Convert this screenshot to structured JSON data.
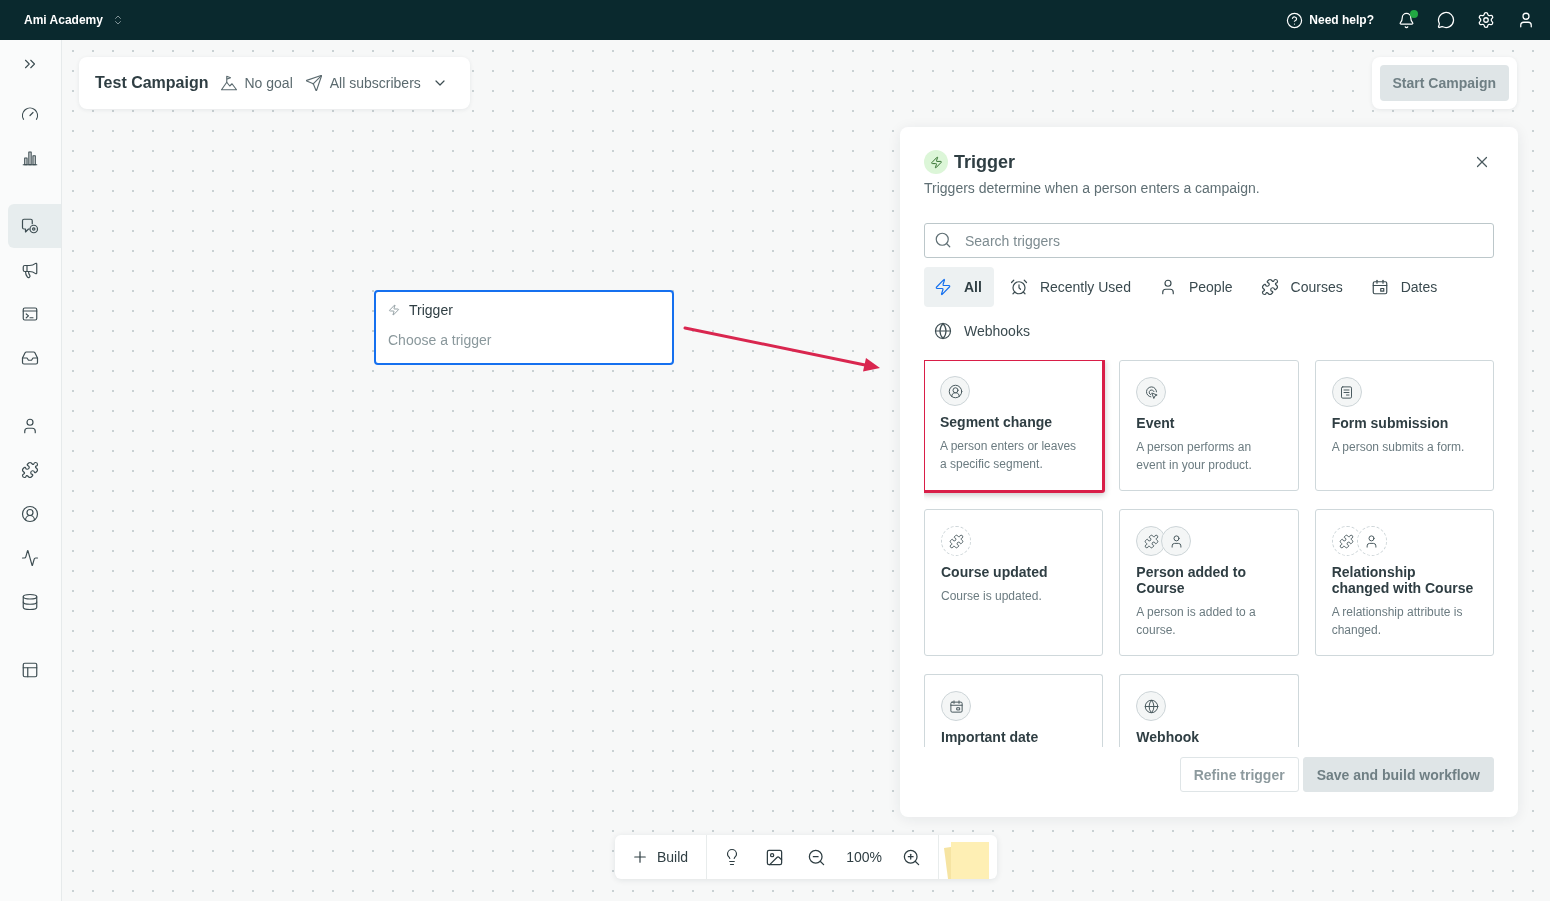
{
  "top_bar": {
    "workspace": "Ami Academy",
    "help": "Need help?",
    "notifications": {
      "unread": true
    }
  },
  "sidebar": {
    "groups": [
      {
        "items": [
          {
            "selected": false
          },
          {
            "selected": false
          }
        ]
      },
      {
        "items": [
          {
            "selected": true
          },
          {
            "selected": false
          },
          {
            "selected": false
          },
          {
            "selected": false
          }
        ]
      },
      {
        "items": [
          {
            "selected": false
          },
          {
            "selected": false
          },
          {
            "selected": false
          },
          {
            "selected": false
          },
          {
            "selected": false
          }
        ]
      },
      {
        "items": [
          {
            "selected": false
          }
        ]
      }
    ]
  },
  "campaign": {
    "title": "Test Campaign",
    "goal": "No goal",
    "audience": "All subscribers"
  },
  "start_campaign": {
    "label": "Start Campaign",
    "disabled": true
  },
  "canvas": {
    "nodes": [
      {
        "title": "Trigger",
        "subtitle": "Choose a trigger",
        "selected": true
      }
    ]
  },
  "trigger_panel": {
    "title": "Trigger",
    "description": "Triggers determine when a person enters a campaign.",
    "search": {
      "placeholder": "Search triggers"
    },
    "tabs": [
      {
        "label": "All",
        "selected": true
      },
      {
        "label": "Recently Used",
        "selected": false
      },
      {
        "label": "People",
        "selected": false
      },
      {
        "label": "Courses",
        "selected": false
      },
      {
        "label": "Dates",
        "selected": false
      },
      {
        "label": "Webhooks",
        "selected": false
      }
    ],
    "cards": [
      {
        "kind": "segment",
        "title": "Segment change",
        "description": "A person enters or leaves a specific segment.",
        "highlighted": true
      },
      {
        "kind": "event",
        "title": "Event",
        "description": "A person performs an event in your product.",
        "highlighted": false
      },
      {
        "kind": "form",
        "title": "Form submission",
        "description": "A person submits a form.",
        "highlighted": false
      },
      {
        "kind": "course",
        "title": "Course updated",
        "description": "Course is updated.",
        "highlighted": false
      },
      {
        "kind": "person_course",
        "title": "Person added to Course",
        "description": "A person is added to a course.",
        "highlighted": false
      },
      {
        "kind": "relationship",
        "title": "Relationship changed with Course",
        "description": "A relationship attribute is changed.",
        "highlighted": false
      },
      {
        "kind": "date",
        "title": "Important date",
        "highlighted": false
      },
      {
        "kind": "webhook",
        "title": "Webhook",
        "highlighted": false
      }
    ],
    "buttons": [
      {
        "kind": "secondary",
        "label": "Refine trigger",
        "disabled": true
      },
      {
        "kind": "primary",
        "label": "Save and build workflow",
        "disabled": true
      }
    ]
  },
  "toolbar": {
    "build": "Build",
    "zoom": "100%"
  }
}
